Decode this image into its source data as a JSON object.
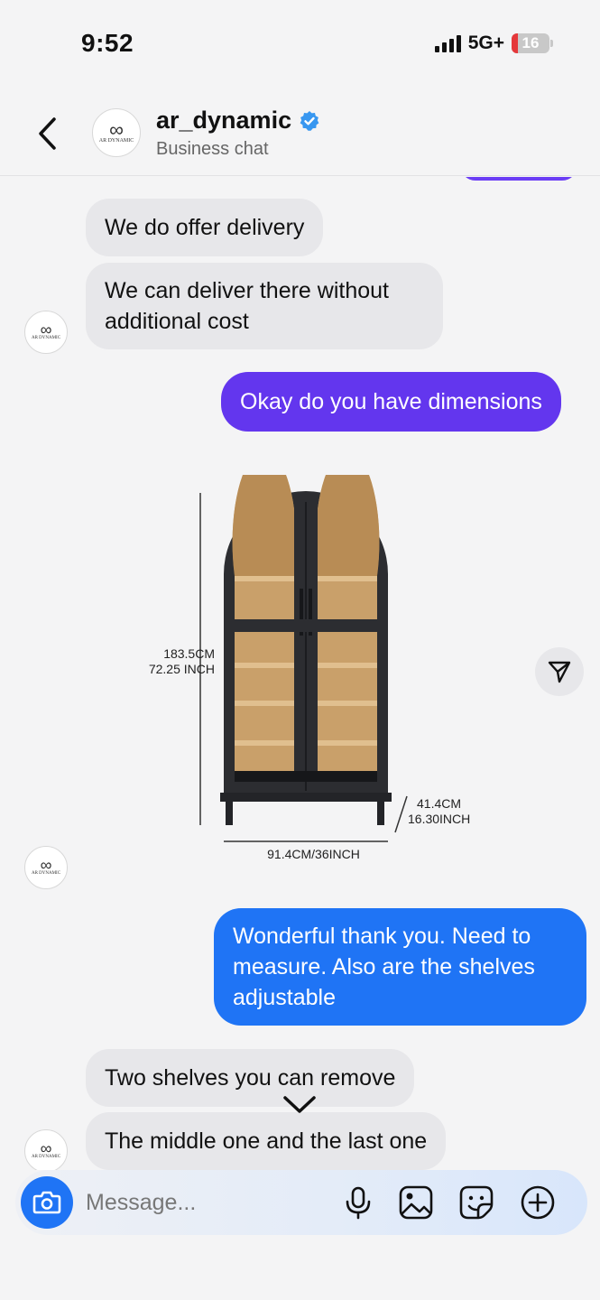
{
  "status_bar": {
    "time": "9:52",
    "network": "5G+",
    "battery_level": "16",
    "battery_fraction": 0.16,
    "battery_color": "#e5383b"
  },
  "header": {
    "name": "ar_dynamic",
    "subtitle": "Business chat",
    "verified": true,
    "avatar_logo_text": "AR DYNAMIC",
    "avatar_logo_tagline": "LIVE YOUR DREAMS"
  },
  "messages": [
    {
      "direction": "in",
      "text": "We do offer delivery"
    },
    {
      "direction": "in",
      "text": "We can deliver there without additional cost"
    },
    {
      "direction": "out",
      "text": "Okay do you have dimensions",
      "color": "#6336ee"
    },
    {
      "direction": "in",
      "type": "image",
      "image": {
        "height_cm": "183.5CM",
        "height_inch": "72.25 INCH",
        "width": "91.4CM/36INCH",
        "depth_cm": "41.4CM",
        "depth_inch": "16.30INCH"
      }
    },
    {
      "direction": "out",
      "text": "Wonderful thank you. Need to measure. Also are the shelves adjustable",
      "color": "#1f74f5"
    },
    {
      "direction": "in",
      "text": "Two shelves you can remove"
    },
    {
      "direction": "in",
      "text": "The middle one and the last one"
    }
  ],
  "composer": {
    "placeholder": "Message..."
  },
  "colors": {
    "accent_blue": "#1f74f5",
    "accent_purple": "#6336ee",
    "incoming_bubble": "#e7e7ea",
    "verified_badge": "#3897f0"
  },
  "icons": [
    "back-chevron-icon",
    "verified-badge-icon",
    "share-icon",
    "chevron-down-icon",
    "camera-icon",
    "microphone-icon",
    "gallery-icon",
    "sticker-icon",
    "plus-icon"
  ]
}
